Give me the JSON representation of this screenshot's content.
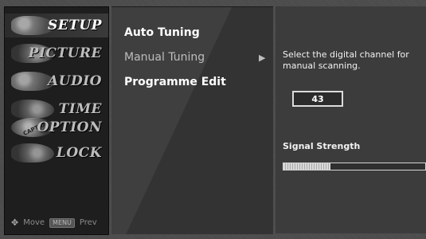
{
  "sidebar": {
    "categories": [
      {
        "label": "SETUP",
        "active": true
      },
      {
        "label": "PICTURE"
      },
      {
        "label": "AUDIO"
      },
      {
        "label": "TIME"
      },
      {
        "label": "OPTION"
      },
      {
        "label": "LOCK"
      }
    ],
    "caption_thumb_text": "CAPTION",
    "nav": {
      "move": "Move",
      "menu_key": "MENU",
      "prev": "Prev"
    }
  },
  "menu": {
    "items": [
      {
        "label": "Auto Tuning"
      },
      {
        "label": "Manual Tuning",
        "selected": true
      },
      {
        "label": "Programme Edit"
      }
    ]
  },
  "detail": {
    "instruction": "Select the digital channel for manual scanning.",
    "channel": "43",
    "signal_label": "Signal Strength",
    "signal_fraction": 0.33
  }
}
